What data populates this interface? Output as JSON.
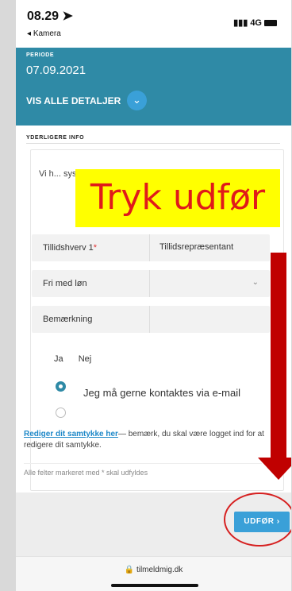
{
  "status_bar": {
    "time": "08.29",
    "back_label": "Kamera",
    "network": "4G"
  },
  "header": {
    "periode_label": "PERIODE",
    "periode_value": "07.09.2021",
    "details_label": "VIS ALLE DETALJER"
  },
  "section": {
    "title": "YDERLIGERE INFO"
  },
  "info_text": "Vi h... sys... kun... Ud...",
  "fields": [
    {
      "label": "Tillidshverv 1",
      "required": true,
      "value": "Tillidsrepræsentant"
    },
    {
      "label": "Fri med løn",
      "required": false,
      "value": ""
    },
    {
      "label": "Bemærkning",
      "required": false,
      "value": ""
    }
  ],
  "radio": {
    "yes_label": "Ja",
    "no_label": "Nej",
    "option_label": "Jeg må gerne kontaktes via e-mail"
  },
  "consent": {
    "link": "Rediger dit samtykke her",
    "text": "— bemærk, du skal være logget ind for at redigere dit samtykke."
  },
  "required_note": "Alle felter markeret med * skal udfyldes",
  "submit_label": "UDFØR",
  "url": "tilmeldmig.dk",
  "annotation": {
    "text": "Tryk udfør",
    "color": "#e01a1a",
    "highlight": "#ffff00"
  }
}
